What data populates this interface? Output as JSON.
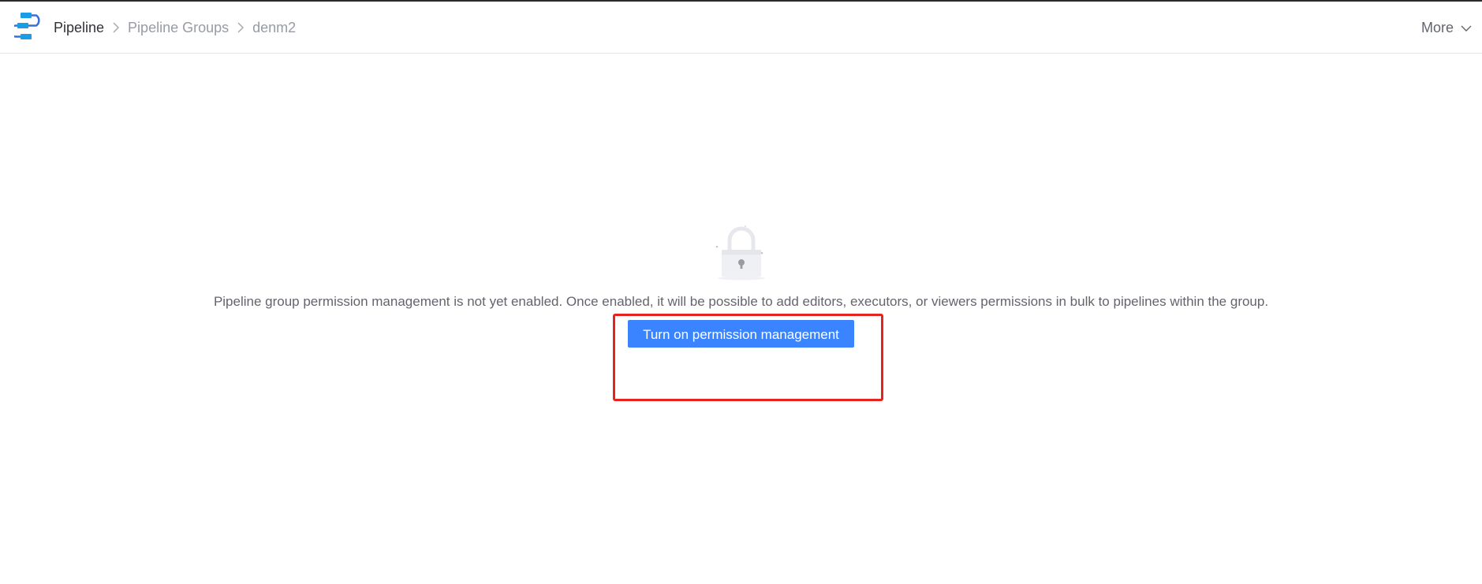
{
  "header": {
    "breadcrumb": [
      {
        "label": "Pipeline"
      },
      {
        "label": "Pipeline Groups"
      },
      {
        "label": "denm2"
      }
    ],
    "more_label": "More",
    "icons": {
      "logo": "pipeline-logo-icon",
      "separator": "chevron-right-icon",
      "more": "chevron-down-icon"
    }
  },
  "empty_state": {
    "icon": "lock-icon",
    "description": "Pipeline group permission management is not yet enabled. Once enabled, it will be possible to add editors, executors, or viewers permissions in bulk to pipelines within the group.",
    "button_label": "Turn on permission management"
  },
  "colors": {
    "primary": "#3a84ff",
    "highlight": "#e8231f",
    "logo": "#1a9de6"
  }
}
